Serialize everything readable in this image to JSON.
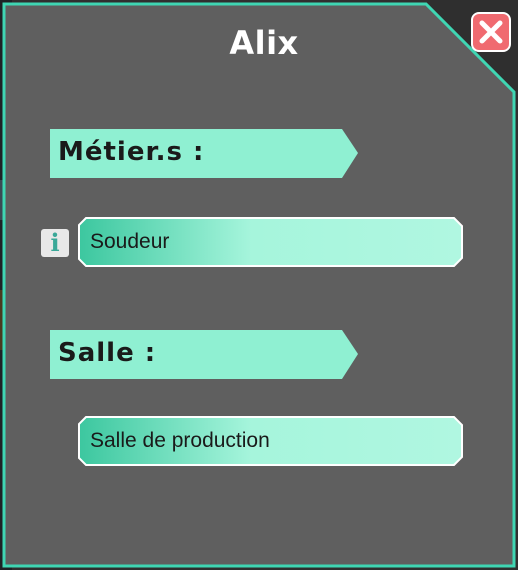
{
  "dialog": {
    "title": "Alix",
    "close_icon": "close-x-icon"
  },
  "sections": {
    "jobs": {
      "label": "Métier.s :",
      "value": "Soudeur",
      "info_icon_glyph": "i"
    },
    "room": {
      "label": "Salle :",
      "value": "Salle de production"
    }
  },
  "colors": {
    "panel": "#5f5f5f",
    "border": "#3fd6b3",
    "accent": "#8ff0d2",
    "close": "#f06a70"
  }
}
